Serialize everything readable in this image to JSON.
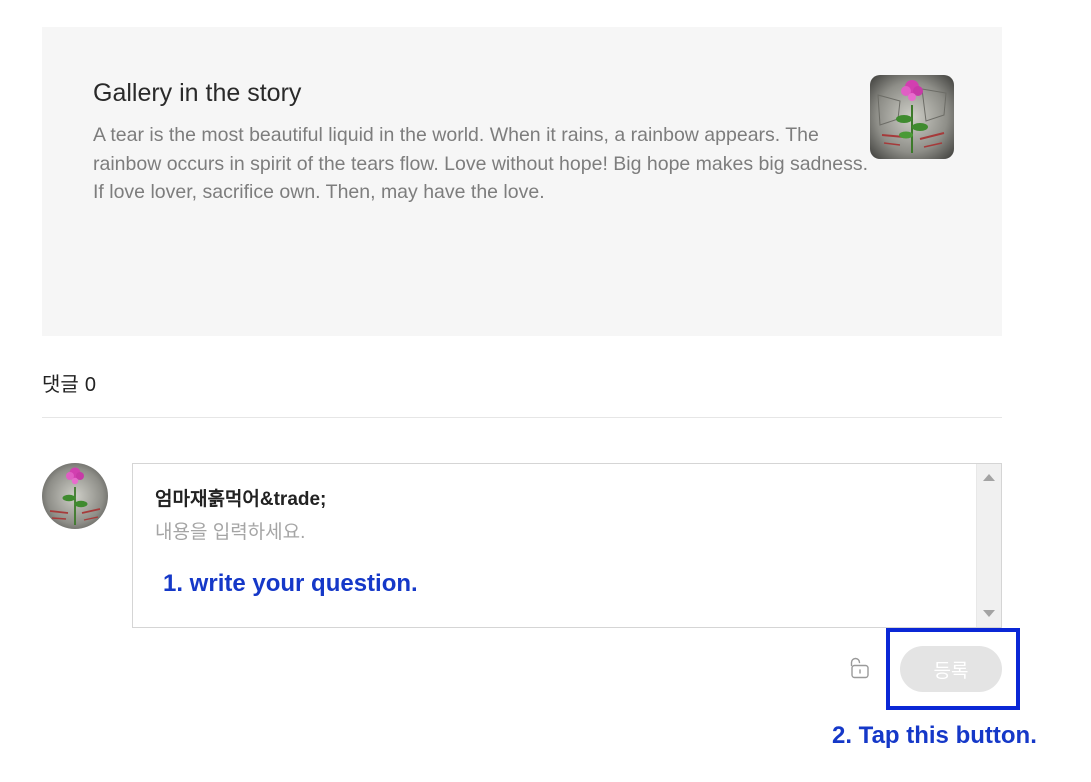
{
  "story": {
    "title": "Gallery in the story",
    "description": "A tear is the most beautiful liquid in the world. When it rains, a rainbow appears. The rainbow occurs in spirit of the tears flow. Love without hope! Big hope makes big sadness. If love lover, sacrifice own. Then, may have the love."
  },
  "comments": {
    "label": "댓글",
    "count": "0"
  },
  "comment_form": {
    "author": "엄마재흙먹어&trade;",
    "placeholder": "내용을 입력하세요.",
    "value": "",
    "submit_label": "등록"
  },
  "annotations": {
    "step1": "1. write your question.",
    "step2": "2. Tap this button."
  },
  "colors": {
    "card_bg": "#f6f6f6",
    "annotation": "#1538c8",
    "highlight_border": "#0a27d6",
    "submit_disabled": "#e4e4e4"
  },
  "icons": {
    "lock": "lock-open-icon"
  }
}
